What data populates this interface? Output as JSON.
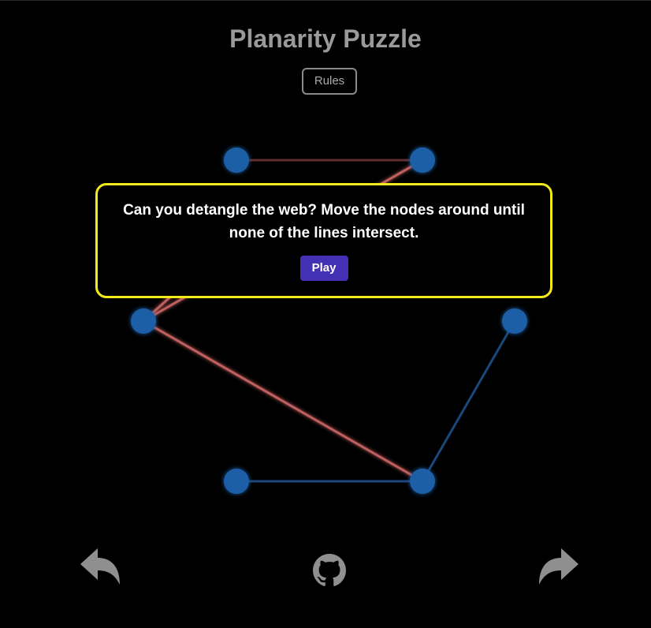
{
  "header": {
    "title": "Planarity Puzzle",
    "rules_label": "Rules"
  },
  "dialog": {
    "message": "Can you detangle the web? Move the nodes around until none of the lines intersect.",
    "play_label": "Play"
  },
  "puzzle": {
    "node_count": 6,
    "edge_count": 8,
    "node_color": "#1b5ea6",
    "crossing_edge_color": "#e2706f",
    "free_edge_color": "#1d4f8a"
  },
  "footer": {
    "undo_icon": "undo-arrow-icon",
    "github_icon": "github-icon",
    "redo_icon": "redo-arrow-icon"
  },
  "colors": {
    "background": "#000000",
    "title": "#9a9a9a",
    "dialog_border": "#f2ea19",
    "play_button": "#4330b4",
    "footer_icons": "#8f8f8f"
  }
}
